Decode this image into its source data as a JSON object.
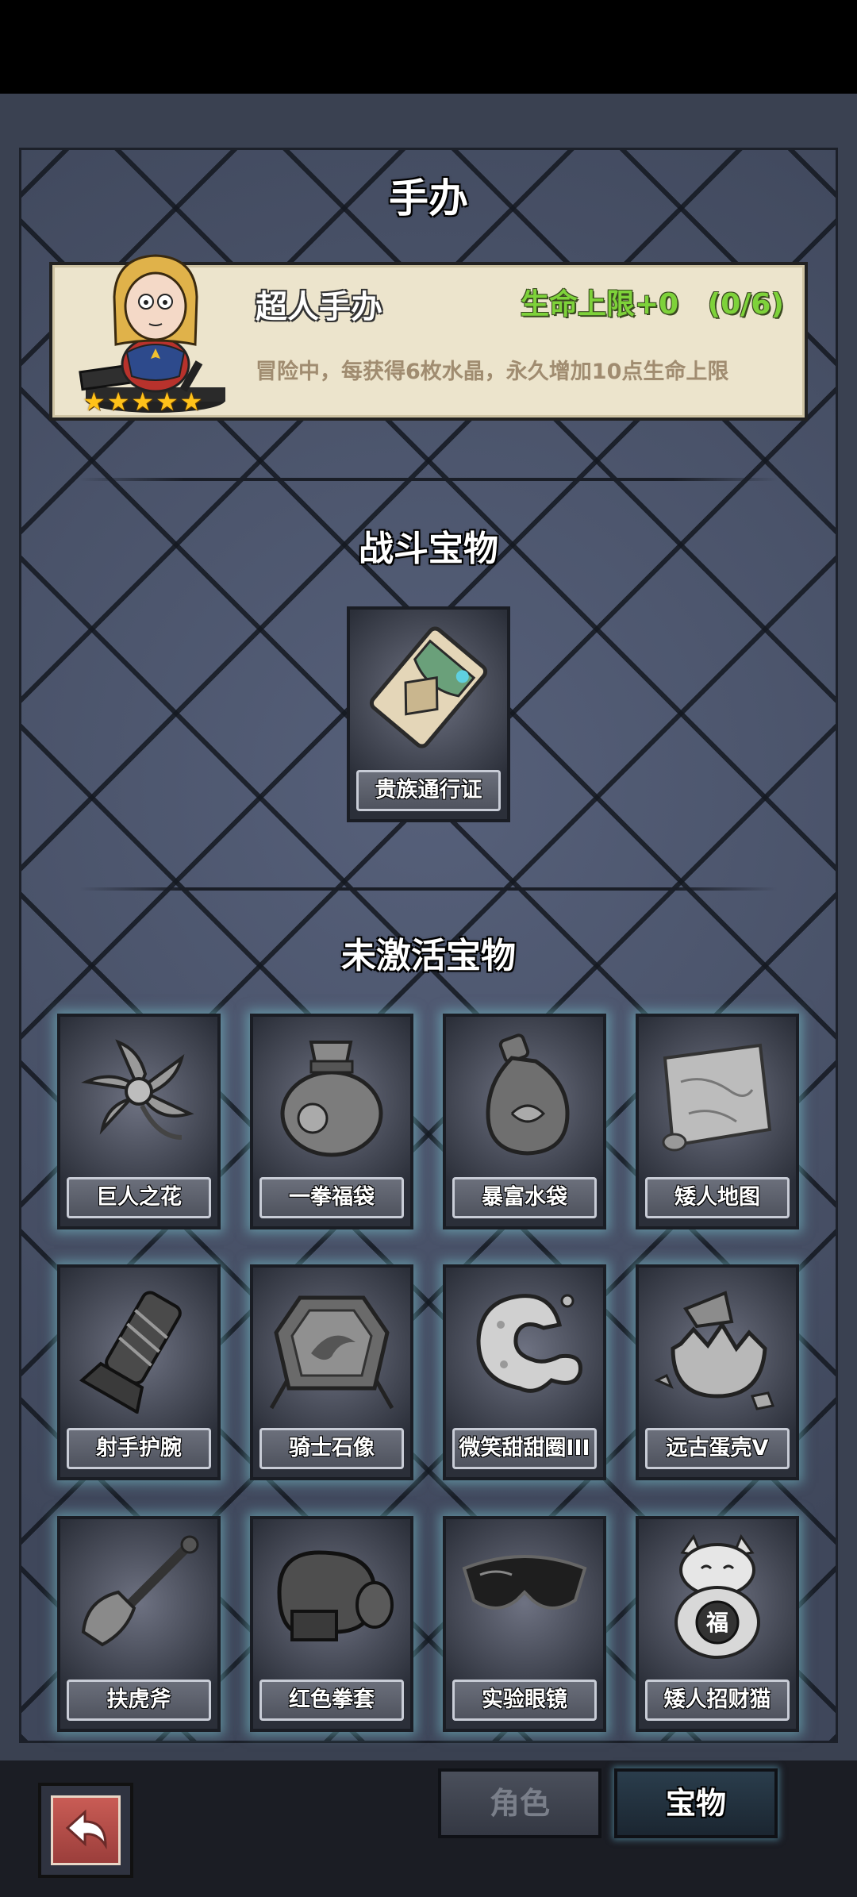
{
  "page_title": "手办",
  "figure": {
    "name": "超人手办",
    "bonus": "生命上限+0",
    "progress": "(0/6)",
    "description": "冒险中，每获得6枚水晶，永久增加10点生命上限",
    "stars": 5
  },
  "battle_section": {
    "title": "战斗宝物",
    "items": [
      {
        "label": "贵族通行证",
        "icon": "noble-pass-card"
      }
    ]
  },
  "inactive_section": {
    "title": "未激活宝物",
    "items": [
      {
        "label": "巨人之花",
        "icon": "giant-flower"
      },
      {
        "label": "一拳福袋",
        "icon": "fist-lucky-bag"
      },
      {
        "label": "暴富水袋",
        "icon": "water-pouch"
      },
      {
        "label": "矮人地图",
        "icon": "dwarf-map-scroll"
      },
      {
        "label": "射手护腕",
        "icon": "archer-bracer"
      },
      {
        "label": "骑士石像",
        "icon": "knight-stone-statue"
      },
      {
        "label": "微笑甜甜圈III",
        "icon": "smiling-donut"
      },
      {
        "label": "远古蛋壳V",
        "icon": "ancient-eggshell"
      },
      {
        "label": "扶虎斧",
        "icon": "tiger-axe"
      },
      {
        "label": "红色拳套",
        "icon": "boxing-glove"
      },
      {
        "label": "实验眼镜",
        "icon": "lab-goggles"
      },
      {
        "label": "矮人招财猫",
        "icon": "lucky-cat"
      }
    ]
  },
  "tabs": {
    "role": "角色",
    "treasure": "宝物"
  },
  "colors": {
    "bonus_green": "#7ed23a",
    "star_gold": "#ffc21a",
    "card_glow": "#78c8d2"
  }
}
